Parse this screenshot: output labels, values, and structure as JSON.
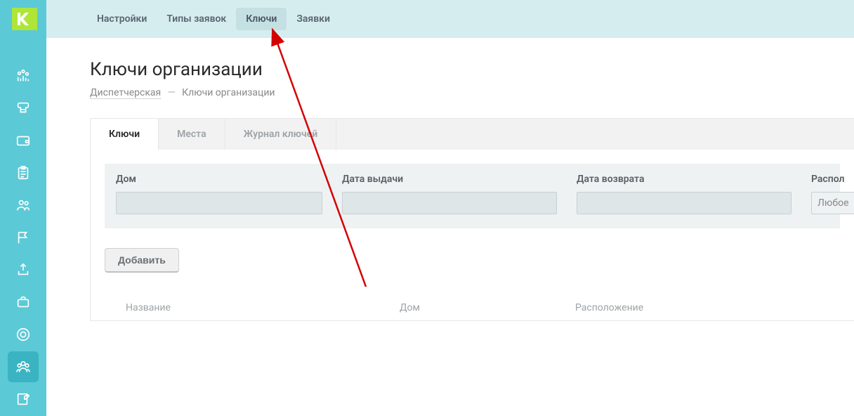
{
  "top_tabs": [
    {
      "label": "Настройки",
      "active": false
    },
    {
      "label": "Типы заявок",
      "active": false
    },
    {
      "label": "Ключи",
      "active": true
    },
    {
      "label": "Заявки",
      "active": false
    }
  ],
  "page": {
    "title": "Ключи организации",
    "breadcrumb_root": "Диспетчерская",
    "breadcrumb_sep": "—",
    "breadcrumb_current": "Ключи организации"
  },
  "content_tabs": [
    {
      "label": "Ключи",
      "active": true
    },
    {
      "label": "Места",
      "active": false
    },
    {
      "label": "Журнал ключей",
      "active": false
    }
  ],
  "filters": {
    "house_label": "Дом",
    "issue_date_label": "Дата выдачи",
    "return_date_label": "Дата возврата",
    "location_label": "Распол",
    "location_value": "Любое"
  },
  "buttons": {
    "add": "Добавить"
  },
  "table_headers": {
    "name": "Название",
    "house": "Дом",
    "location": "Расположение"
  }
}
